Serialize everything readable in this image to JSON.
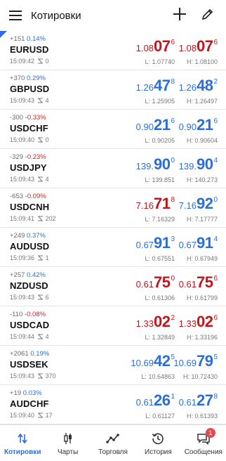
{
  "header": {
    "title": "Котировки"
  },
  "quotes": [
    {
      "change": "+151",
      "percent": "0.14%",
      "dir": "pos",
      "symbol": "EURUSD",
      "time": "15:09:42",
      "spread": "0",
      "bid": {
        "small": "1.08",
        "big": "07",
        "sup": "6",
        "color": "down"
      },
      "ask": {
        "small": "1.08",
        "big": "07",
        "sup": "6",
        "color": "down"
      },
      "low": "L: 1.07740",
      "high": "H: 1.08100"
    },
    {
      "change": "+370",
      "percent": "0.29%",
      "dir": "pos",
      "symbol": "GBPUSD",
      "time": "15:09:43",
      "spread": "4",
      "bid": {
        "small": "1.26",
        "big": "47",
        "sup": "8",
        "color": "up"
      },
      "ask": {
        "small": "1.26",
        "big": "48",
        "sup": "2",
        "color": "up"
      },
      "low": "L: 1.25905",
      "high": "H: 1.26497"
    },
    {
      "change": "-300",
      "percent": "-0.33%",
      "dir": "neg",
      "symbol": "USDCHF",
      "time": "15:09:40",
      "spread": "0",
      "bid": {
        "small": "0.90",
        "big": "21",
        "sup": "6",
        "color": "up"
      },
      "ask": {
        "small": "0.90",
        "big": "21",
        "sup": "6",
        "color": "up"
      },
      "low": "L: 0.90205",
      "high": "H: 0.90604"
    },
    {
      "change": "-329",
      "percent": "-0.23%",
      "dir": "neg",
      "symbol": "USDJPY",
      "time": "15:09:43",
      "spread": "4",
      "bid": {
        "small": "139.",
        "big": "90",
        "sup": "0",
        "color": "up"
      },
      "ask": {
        "small": "139.",
        "big": "90",
        "sup": "4",
        "color": "up"
      },
      "low": "L: 139.851",
      "high": "H: 140.273"
    },
    {
      "change": "-653",
      "percent": "-0.09%",
      "dir": "neg",
      "symbol": "USDCNH",
      "time": "15:09:41",
      "spread": "202",
      "bid": {
        "small": "7.16",
        "big": "71",
        "sup": "8",
        "color": "down"
      },
      "ask": {
        "small": "7.16",
        "big": "92",
        "sup": "0",
        "color": "up"
      },
      "low": "L: 7.16329",
      "high": "H: 7.17777"
    },
    {
      "change": "+249",
      "percent": "0.37%",
      "dir": "pos",
      "symbol": "AUDUSD",
      "time": "15:09:36",
      "spread": "1",
      "bid": {
        "small": "0.67",
        "big": "91",
        "sup": "3",
        "color": "up"
      },
      "ask": {
        "small": "0.67",
        "big": "91",
        "sup": "4",
        "color": "up"
      },
      "low": "L: 0.67551",
      "high": "H: 0.67949"
    },
    {
      "change": "+257",
      "percent": "0.42%",
      "dir": "pos",
      "symbol": "NZDUSD",
      "time": "15:09:43",
      "spread": "6",
      "bid": {
        "small": "0.61",
        "big": "75",
        "sup": "0",
        "color": "down"
      },
      "ask": {
        "small": "0.61",
        "big": "75",
        "sup": "6",
        "color": "down"
      },
      "low": "L: 0.61306",
      "high": "H: 0.61799"
    },
    {
      "change": "-110",
      "percent": "-0.08%",
      "dir": "neg",
      "symbol": "USDCAD",
      "time": "15:09:44",
      "spread": "4",
      "bid": {
        "small": "1.33",
        "big": "02",
        "sup": "2",
        "color": "down"
      },
      "ask": {
        "small": "1.33",
        "big": "02",
        "sup": "6",
        "color": "down"
      },
      "low": "L: 1.32849",
      "high": "H: 1.33196"
    },
    {
      "change": "+2061",
      "percent": "0.19%",
      "dir": "pos",
      "symbol": "USDSEK",
      "time": "15:09:43",
      "spread": "370",
      "bid": {
        "small": "10.69",
        "big": "42",
        "sup": "5",
        "color": "up"
      },
      "ask": {
        "small": "10.69",
        "big": "79",
        "sup": "5",
        "color": "up"
      },
      "low": "L: 10.64863",
      "high": "H: 10.72430"
    },
    {
      "change": "+19",
      "percent": "0.03%",
      "dir": "pos",
      "symbol": "AUDCHF",
      "time": "15:09:40",
      "spread": "17",
      "bid": {
        "small": "0.61",
        "big": "26",
        "sup": "1",
        "color": "up"
      },
      "ask": {
        "small": "0.61",
        "big": "27",
        "sup": "8",
        "color": "up"
      },
      "low": "L: 0.61127",
      "high": "H: 0.61393"
    }
  ],
  "bottom_nav": {
    "quotes": "Котировки",
    "charts": "Чарты",
    "trade": "Торговля",
    "history": "История",
    "messages": "Сообщения",
    "messages_badge": "1"
  },
  "colors": {
    "accent": "#2a6fe0",
    "up": "#2b6fd6",
    "down": "#c3161c",
    "badge": "#e5484d"
  }
}
